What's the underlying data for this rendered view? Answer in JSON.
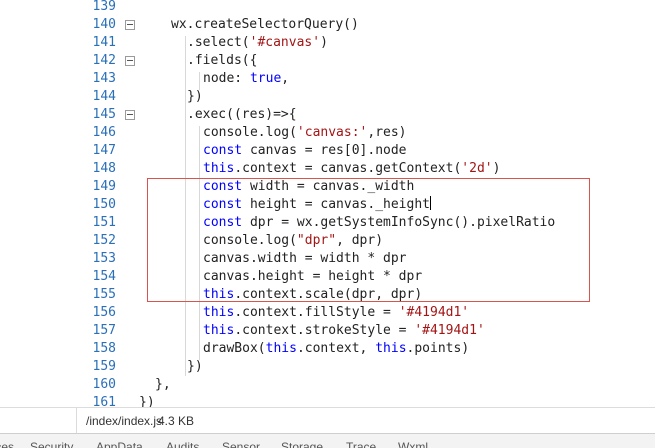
{
  "editor": {
    "lines": [
      {
        "num": "139",
        "fold": false,
        "segments": []
      },
      {
        "num": "140",
        "fold": true,
        "segments": [
          {
            "t": "wx.createSelectorQuery()",
            "c": "p"
          }
        ],
        "indent": 23
      },
      {
        "num": "141",
        "fold": false,
        "segments": [
          {
            "t": ".select(",
            "c": "p"
          },
          {
            "t": "'#canvas'",
            "c": "s"
          },
          {
            "t": ")",
            "c": "p"
          }
        ],
        "indent": 39
      },
      {
        "num": "142",
        "fold": true,
        "segments": [
          {
            "t": ".fields({",
            "c": "p"
          }
        ],
        "indent": 39
      },
      {
        "num": "143",
        "fold": false,
        "segments": [
          {
            "t": "node: ",
            "c": "p"
          },
          {
            "t": "true",
            "c": "k"
          },
          {
            "t": ",",
            "c": "p"
          }
        ],
        "indent": 55
      },
      {
        "num": "144",
        "fold": false,
        "segments": [
          {
            "t": "})",
            "c": "p"
          }
        ],
        "indent": 39
      },
      {
        "num": "145",
        "fold": true,
        "segments": [
          {
            "t": ".exec((res)=>{",
            "c": "p"
          }
        ],
        "indent": 39
      },
      {
        "num": "146",
        "fold": false,
        "segments": [
          {
            "t": "console.log(",
            "c": "p"
          },
          {
            "t": "'canvas:'",
            "c": "s"
          },
          {
            "t": ",res)",
            "c": "p"
          }
        ],
        "indent": 55
      },
      {
        "num": "147",
        "fold": false,
        "segments": [
          {
            "t": "const",
            "c": "k"
          },
          {
            "t": " canvas = res[0].node",
            "c": "p"
          }
        ],
        "indent": 55
      },
      {
        "num": "148",
        "fold": false,
        "segments": [
          {
            "t": "this",
            "c": "k"
          },
          {
            "t": ".context = canvas.getContext(",
            "c": "p"
          },
          {
            "t": "'2d'",
            "c": "s"
          },
          {
            "t": ")",
            "c": "p"
          }
        ],
        "indent": 55
      },
      {
        "num": "149",
        "fold": false,
        "segments": [
          {
            "t": "const",
            "c": "k"
          },
          {
            "t": " width = canvas._width",
            "c": "p"
          }
        ],
        "indent": 55
      },
      {
        "num": "150",
        "fold": false,
        "segments": [
          {
            "t": "const",
            "c": "k"
          },
          {
            "t": " height = canvas._height",
            "c": "p"
          },
          {
            "t": "",
            "c": "caret"
          }
        ],
        "indent": 55
      },
      {
        "num": "151",
        "fold": false,
        "segments": [
          {
            "t": "const",
            "c": "k"
          },
          {
            "t": " dpr = wx.getSystemInfoSync().pixelRatio",
            "c": "p"
          }
        ],
        "indent": 55
      },
      {
        "num": "152",
        "fold": false,
        "segments": [
          {
            "t": "console.log(",
            "c": "p"
          },
          {
            "t": "\"dpr\"",
            "c": "s"
          },
          {
            "t": ", dpr)",
            "c": "p"
          }
        ],
        "indent": 55
      },
      {
        "num": "153",
        "fold": false,
        "segments": [
          {
            "t": "canvas.width = width * dpr",
            "c": "p"
          }
        ],
        "indent": 55
      },
      {
        "num": "154",
        "fold": false,
        "segments": [
          {
            "t": "canvas.height = height * dpr",
            "c": "p"
          }
        ],
        "indent": 55
      },
      {
        "num": "155",
        "fold": false,
        "segments": [
          {
            "t": "this",
            "c": "k"
          },
          {
            "t": ".context.scale(dpr, dpr)",
            "c": "p"
          }
        ],
        "indent": 55
      },
      {
        "num": "156",
        "fold": false,
        "segments": [
          {
            "t": "this",
            "c": "k"
          },
          {
            "t": ".context.fillStyle = ",
            "c": "p"
          },
          {
            "t": "'#4194d1'",
            "c": "s"
          }
        ],
        "indent": 55
      },
      {
        "num": "157",
        "fold": false,
        "segments": [
          {
            "t": "this",
            "c": "k"
          },
          {
            "t": ".context.strokeStyle = ",
            "c": "p"
          },
          {
            "t": "'#4194d1'",
            "c": "s"
          }
        ],
        "indent": 55
      },
      {
        "num": "158",
        "fold": false,
        "segments": [
          {
            "t": "drawBox(",
            "c": "p"
          },
          {
            "t": "this",
            "c": "k"
          },
          {
            "t": ".context, ",
            "c": "p"
          },
          {
            "t": "this",
            "c": "k"
          },
          {
            "t": ".points)",
            "c": "p"
          }
        ],
        "indent": 55
      },
      {
        "num": "159",
        "fold": false,
        "segments": [
          {
            "t": "})",
            "c": "p"
          }
        ],
        "indent": 39
      },
      {
        "num": "160",
        "fold": false,
        "segments": [
          {
            "t": "},",
            "c": "p"
          }
        ],
        "indent": 7
      },
      {
        "num": "161",
        "fold": false,
        "segments": [
          {
            "t": "})",
            "c": "p"
          }
        ],
        "indent": -9
      }
    ]
  },
  "status": {
    "file_path": "/index/index.js",
    "file_size": "4.3 KB"
  },
  "tabs": {
    "items": [
      "Sources",
      "Security",
      "AppData",
      "Audits",
      "Sensor",
      "Storage",
      "Trace",
      "Wxml"
    ]
  },
  "colors": {
    "keyword": "#0000ff",
    "string": "#a31515",
    "line_number": "#2a6fb8",
    "highlight_border": "#d9534f"
  }
}
